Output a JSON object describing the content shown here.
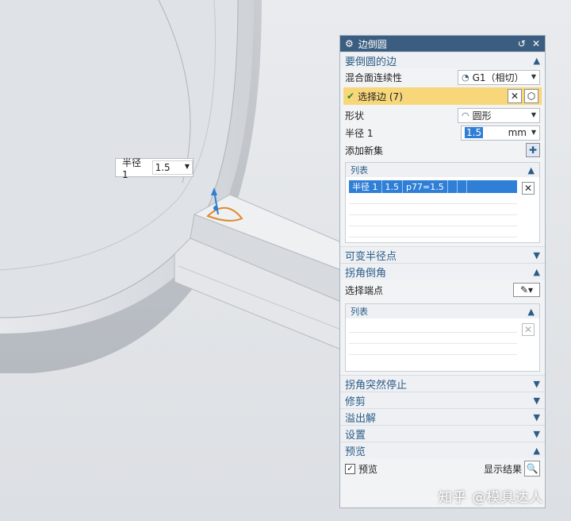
{
  "float_field": {
    "label": "半径 1",
    "value": "1.5"
  },
  "dialog": {
    "title": "边倒圆",
    "section_edges": {
      "title": "要倒圆的边",
      "continuity_label": "混合面连续性",
      "continuity_value": "G1（相切）",
      "select_edge_label": "选择边 (7)",
      "shape_label": "形状",
      "shape_value": "圆形",
      "radius_label": "半径 1",
      "radius_value": "1.5",
      "radius_unit": "mm",
      "add_set_label": "添加新集",
      "list_title": "列表",
      "list_rows": [
        [
          "半径 1",
          "1.5",
          "p77=1.5"
        ]
      ]
    },
    "section_variable": {
      "title": "可变半径点"
    },
    "section_corner": {
      "title": "拐角倒角",
      "select_endpoint_label": "选择端点",
      "list_title": "列表"
    },
    "section_stop": {
      "title": "拐角突然停止"
    },
    "section_trim": {
      "title": "修剪"
    },
    "section_overflow": {
      "title": "溢出解"
    },
    "section_settings": {
      "title": "设置"
    },
    "section_preview": {
      "title": "预览",
      "preview_label": "预览",
      "show_result_label": "显示结果"
    }
  },
  "watermark": "知乎 @模具达人",
  "colors": {
    "title_bar": "#3b5e80",
    "section_text": "#2b5d87",
    "selection": "#f7d77a",
    "list_highlight": "#2f7fd6"
  }
}
